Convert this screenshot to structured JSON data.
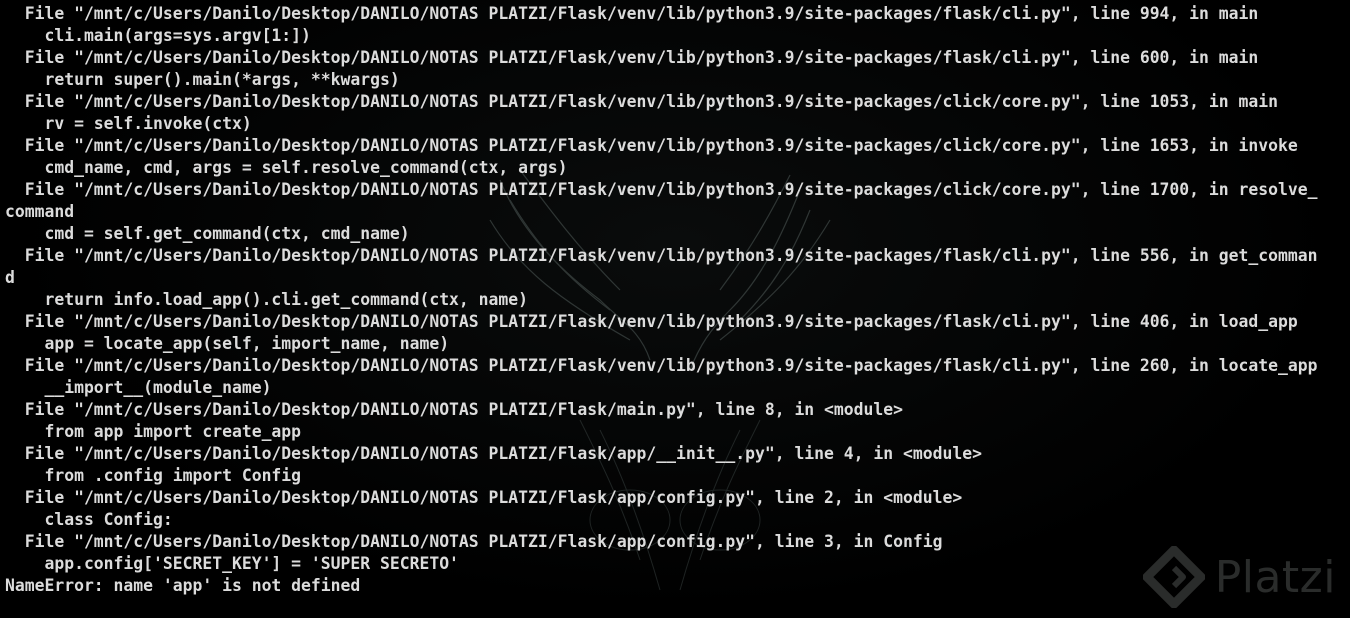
{
  "terminal": {
    "lines": [
      "  File \"/mnt/c/Users/Danilo/Desktop/DANILO/NOTAS PLATZI/Flask/venv/lib/python3.9/site-packages/flask/cli.py\", line 994, in main",
      "    cli.main(args=sys.argv[1:])",
      "  File \"/mnt/c/Users/Danilo/Desktop/DANILO/NOTAS PLATZI/Flask/venv/lib/python3.9/site-packages/flask/cli.py\", line 600, in main",
      "    return super().main(*args, **kwargs)",
      "  File \"/mnt/c/Users/Danilo/Desktop/DANILO/NOTAS PLATZI/Flask/venv/lib/python3.9/site-packages/click/core.py\", line 1053, in main",
      "    rv = self.invoke(ctx)",
      "  File \"/mnt/c/Users/Danilo/Desktop/DANILO/NOTAS PLATZI/Flask/venv/lib/python3.9/site-packages/click/core.py\", line 1653, in invoke",
      "    cmd_name, cmd, args = self.resolve_command(ctx, args)",
      "  File \"/mnt/c/Users/Danilo/Desktop/DANILO/NOTAS PLATZI/Flask/venv/lib/python3.9/site-packages/click/core.py\", line 1700, in resolve_",
      "command",
      "    cmd = self.get_command(ctx, cmd_name)",
      "  File \"/mnt/c/Users/Danilo/Desktop/DANILO/NOTAS PLATZI/Flask/venv/lib/python3.9/site-packages/flask/cli.py\", line 556, in get_comman",
      "d",
      "    return info.load_app().cli.get_command(ctx, name)",
      "  File \"/mnt/c/Users/Danilo/Desktop/DANILO/NOTAS PLATZI/Flask/venv/lib/python3.9/site-packages/flask/cli.py\", line 406, in load_app",
      "    app = locate_app(self, import_name, name)",
      "  File \"/mnt/c/Users/Danilo/Desktop/DANILO/NOTAS PLATZI/Flask/venv/lib/python3.9/site-packages/flask/cli.py\", line 260, in locate_app",
      "    __import__(module_name)",
      "  File \"/mnt/c/Users/Danilo/Desktop/DANILO/NOTAS PLATZI/Flask/main.py\", line 8, in <module>",
      "    from app import create_app",
      "  File \"/mnt/c/Users/Danilo/Desktop/DANILO/NOTAS PLATZI/Flask/app/__init__.py\", line 4, in <module>",
      "    from .config import Config",
      "  File \"/mnt/c/Users/Danilo/Desktop/DANILO/NOTAS PLATZI/Flask/app/config.py\", line 2, in <module>",
      "    class Config:",
      "  File \"/mnt/c/Users/Danilo/Desktop/DANILO/NOTAS PLATZI/Flask/app/config.py\", line 3, in Config",
      "    app.config['SECRET_KEY'] = 'SUPER SECRETO'",
      "NameError: name 'app' is not defined"
    ],
    "text_color": "#dcdcdc",
    "background_color": "#000000"
  },
  "watermark": {
    "text": "Platzi",
    "icon": "platzi-logo-icon"
  }
}
